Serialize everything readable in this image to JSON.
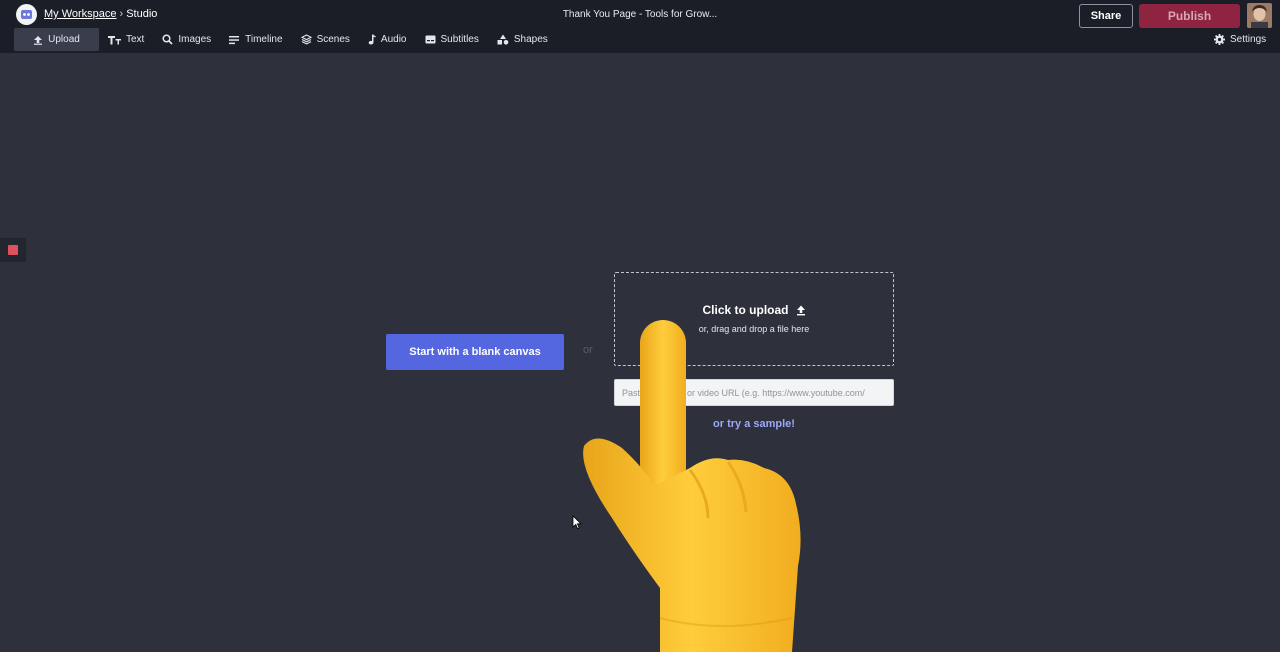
{
  "header": {
    "breadcrumb": {
      "workspace": "My Workspace",
      "separator": "›",
      "current": "Studio"
    },
    "title": "Thank You Page - Tools for Grow...",
    "share_label": "Share",
    "publish_label": "Publish"
  },
  "toolbar": {
    "items": [
      {
        "label": "Upload",
        "icon": "upload-icon"
      },
      {
        "label": "Text",
        "icon": "text-icon"
      },
      {
        "label": "Images",
        "icon": "search-icon"
      },
      {
        "label": "Timeline",
        "icon": "timeline-icon"
      },
      {
        "label": "Scenes",
        "icon": "layers-icon"
      },
      {
        "label": "Audio",
        "icon": "music-note-icon"
      },
      {
        "label": "Subtitles",
        "icon": "subtitles-icon"
      },
      {
        "label": "Shapes",
        "icon": "shapes-icon"
      }
    ],
    "active": "Upload",
    "settings_label": "Settings"
  },
  "main": {
    "blank_canvas_label": "Start with a blank canvas",
    "or_label": "or",
    "upload": {
      "title": "Click to upload",
      "subtitle": "or, drag and drop a file here"
    },
    "url_placeholder": "Paste an image or video URL (e.g. https://www.youtube.com/",
    "sample_link": "or try a sample!"
  },
  "colors": {
    "background": "#2e313c",
    "topbar": "#1b1e26",
    "primary_button": "#5466e0",
    "publish_button": "#8e2442",
    "link": "#9aa8f7",
    "record_indicator": "#e0515b"
  }
}
